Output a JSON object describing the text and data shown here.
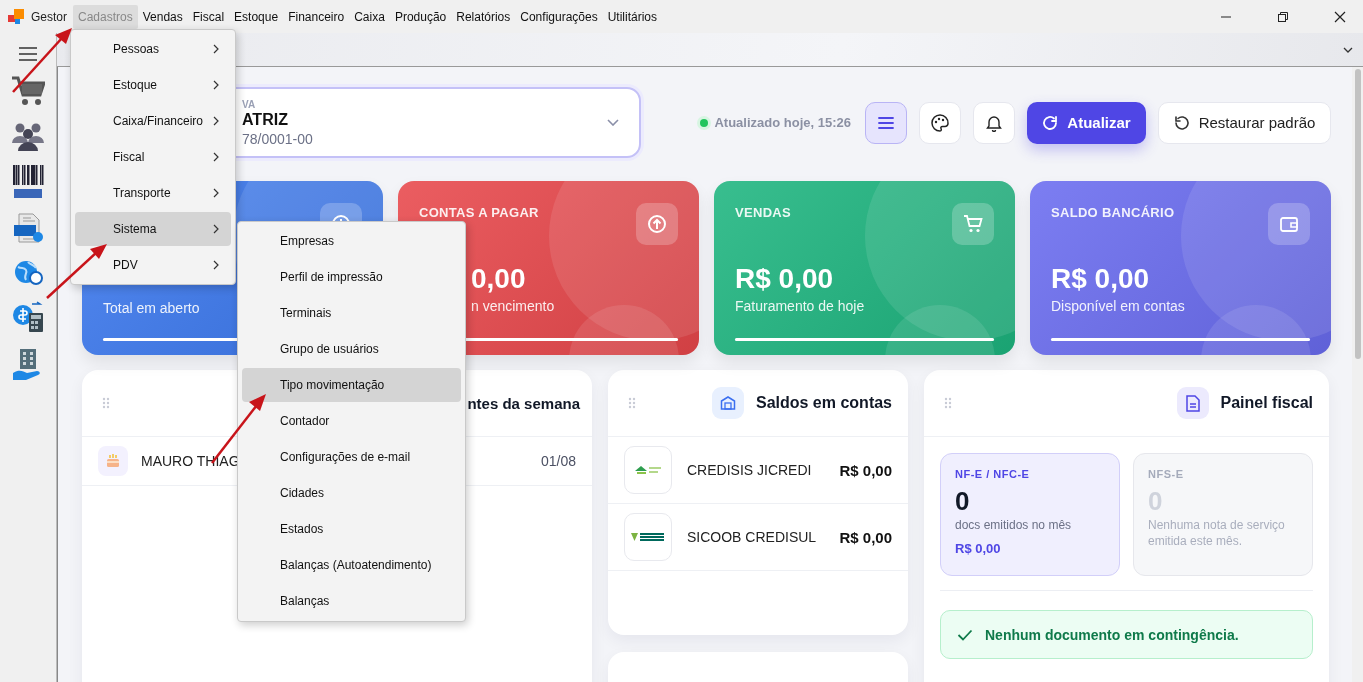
{
  "menu_bar": {
    "app_name": "Gestor",
    "items": [
      {
        "label": "Cadastros",
        "selected": true
      },
      {
        "label": "Vendas",
        "selected": false
      },
      {
        "label": "Fiscal",
        "selected": false
      },
      {
        "label": "Estoque",
        "selected": false
      },
      {
        "label": "Financeiro",
        "selected": false
      },
      {
        "label": "Caixa",
        "selected": false
      },
      {
        "label": "Produção",
        "selected": false
      },
      {
        "label": "Relatórios",
        "selected": false
      },
      {
        "label": "Configurações",
        "selected": false
      },
      {
        "label": "Utilitários",
        "selected": false
      }
    ]
  },
  "open_menu": {
    "items": [
      {
        "label": "Pessoas",
        "has_submenu": true,
        "selected": false
      },
      {
        "label": "Estoque",
        "has_submenu": true,
        "selected": false
      },
      {
        "label": "Caixa/Financeiro",
        "has_submenu": true,
        "selected": false
      },
      {
        "label": "Fiscal",
        "has_submenu": true,
        "selected": false
      },
      {
        "label": "Transporte",
        "has_submenu": true,
        "selected": false
      },
      {
        "label": "Sistema",
        "has_submenu": true,
        "selected": true
      },
      {
        "label": "PDV",
        "has_submenu": true,
        "selected": false
      }
    ]
  },
  "submenu": {
    "items": [
      {
        "label": "Empresas",
        "selected": false
      },
      {
        "label": "Perfil de impressão",
        "selected": false
      },
      {
        "label": "Terminais",
        "selected": false
      },
      {
        "label": "Grupo de usuários",
        "selected": false
      },
      {
        "label": "Tipo movimentação",
        "selected": true
      },
      {
        "label": "Contador",
        "selected": false
      },
      {
        "label": "Configurações de e-mail",
        "selected": false
      },
      {
        "label": "Cidades",
        "selected": false
      },
      {
        "label": "Estados",
        "selected": false
      },
      {
        "label": "Balanças (Autoatendimento)",
        "selected": false
      },
      {
        "label": "Balanças",
        "selected": false
      }
    ]
  },
  "sidebar": {
    "items": [
      {
        "kind": "menu"
      },
      {
        "kind": "cart"
      },
      {
        "kind": "people"
      },
      {
        "kind": "barcode"
      },
      {
        "kind": "document"
      },
      {
        "kind": "globe"
      },
      {
        "kind": "calculator"
      },
      {
        "kind": "building"
      }
    ]
  },
  "company_selector": {
    "label": "VA",
    "name": "ATRIZ",
    "document": "78/0001-00"
  },
  "status": {
    "text": "Atualizado hoje, 15:26",
    "online": true
  },
  "toolbar": [
    {
      "kind": "menu",
      "on": true
    },
    {
      "kind": "palette",
      "on": false
    },
    {
      "kind": "bell",
      "on": false
    }
  ],
  "refresh_button": {
    "label": "Atualizar"
  },
  "reset_button": {
    "label": "Restaurar padrão"
  },
  "stat_cards": [
    {
      "kind": "receivable",
      "color": "#3b78ee",
      "subtitle": "Total em aberto",
      "level": 1
    },
    {
      "kind": "payable",
      "color": "#e8474b",
      "title": "CONTAS A PAGAR",
      "value": "0,00",
      "subtitle": "n vencimento",
      "level": 1
    },
    {
      "kind": "sales",
      "color": "#1db57f",
      "title": "VENDAS",
      "value": "R$ 0,00",
      "subtitle": "Faturamento de hoje",
      "level": 1
    },
    {
      "kind": "bank",
      "color": "#6a6cf0",
      "title": "SALDO BANCÁRIO",
      "value": "R$ 0,00",
      "subtitle": "Disponível em contas",
      "level": 1
    }
  ],
  "birthdays_panel": {
    "title": "ntes da semana",
    "rows": [
      {
        "name": "MAURO THIAG",
        "date": "01/08"
      }
    ]
  },
  "accounts_panel": {
    "title": "Saldos em contas",
    "rows": [
      {
        "kind": "credisis",
        "name": "CREDISIS JICREDI",
        "amount": "R$ 0,00"
      },
      {
        "kind": "sicoob",
        "name": "SICOOB CREDISUL",
        "amount": "R$ 0,00"
      }
    ]
  },
  "fiscal_panel": {
    "title": "Painel fiscal",
    "boxes": [
      {
        "title": "NF-E / NFC-E",
        "count": "0",
        "caption": "docs emitidos no mês",
        "amount": "R$ 0,00",
        "active": true
      },
      {
        "title": "NFS-E",
        "count": "0",
        "caption": "Nenhuma nota de serviço emitida este mês.",
        "active": false
      }
    ],
    "alert": {
      "kind": "success",
      "text": "Nenhum documento em contingência."
    }
  }
}
